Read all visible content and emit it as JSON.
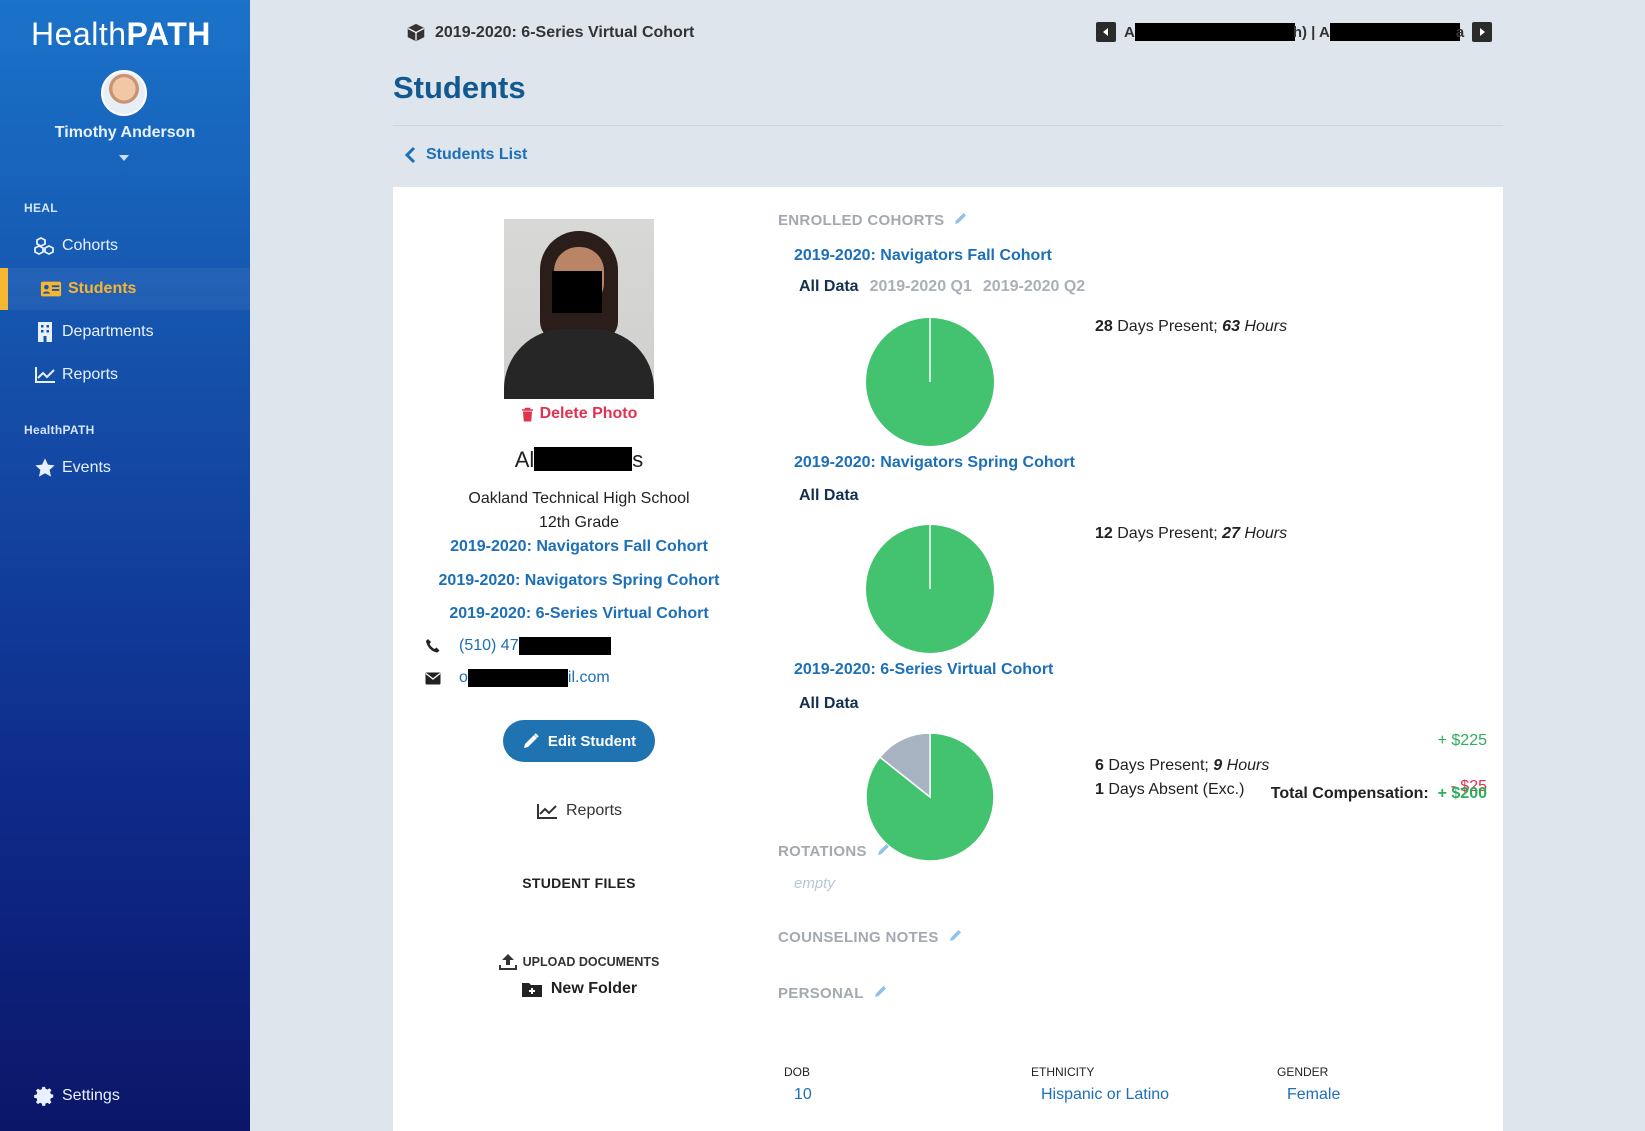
{
  "sidebar": {
    "logo_light": "Health",
    "logo_bold": "PATH",
    "user_name": "Timothy Anderson",
    "sections": {
      "heal": "HEAL",
      "healthpath": "HealthPATH"
    },
    "items": [
      {
        "label": "Cohorts"
      },
      {
        "label": "Students"
      },
      {
        "label": "Departments"
      },
      {
        "label": "Reports"
      },
      {
        "label": "Events"
      },
      {
        "label": "Settings"
      }
    ],
    "active_color": "#f5b731"
  },
  "header": {
    "cohort": "2019-2020: 6-Series Virtual Cohort",
    "student_nav_prefix": "A",
    "student_nav_mid": "h) | A",
    "student_nav_suffix": "a",
    "page_title": "Students",
    "back_link": "Students List"
  },
  "student": {
    "delete_photo": "Delete Photo",
    "name_start": "Al",
    "name_end": "s",
    "school": "Oakland Technical High School",
    "grade": "12th Grade",
    "cohorts": [
      "2019-2020: Navigators Fall Cohort",
      "2019-2020: Navigators Spring Cohort",
      "2019-2020: 6-Series Virtual Cohort"
    ],
    "phone_visible": "(510) 47",
    "email_start": "o",
    "email_end": "il.com",
    "edit_button": "Edit Student",
    "reports_link": "Reports",
    "files_title": "STUDENT FILES",
    "upload": "UPLOAD DOCUMENTS",
    "new_folder": "New Folder"
  },
  "enrolled": {
    "label": "ENROLLED COHORTS",
    "cohorts": [
      {
        "name": "2019-2020: Navigators Fall Cohort",
        "tabs": [
          "All Data",
          "2019-2020 Q1",
          "2019-2020 Q2"
        ],
        "days_present": "28",
        "days_present_text": " Days Present; ",
        "hours": "63",
        "hours_text": " Hours",
        "present_fraction": 1.0
      },
      {
        "name": "2019-2020: Navigators Spring Cohort",
        "tabs": [
          "All Data"
        ],
        "days_present": "12",
        "days_present_text": " Days Present; ",
        "hours": "27",
        "hours_text": " Hours",
        "present_fraction": 1.0
      },
      {
        "name": "2019-2020: 6-Series Virtual Cohort",
        "tabs": [
          "All Data"
        ],
        "days_present": "6",
        "days_present_text": " Days Present; ",
        "hours": "9",
        "hours_text": " Hours",
        "days_absent": "1",
        "days_absent_text": " Days Absent (Exc.)",
        "comp_plus": "+ $225",
        "comp_minus": "- $25",
        "total_label": "Total Compensation:",
        "total_value": "+ $200",
        "present_fraction": 0.857
      }
    ],
    "present_color": "#43c26f",
    "absent_color": "#a8b3c2"
  },
  "rotations": {
    "label": "ROTATIONS",
    "empty": "empty"
  },
  "counseling": {
    "label": "COUNSELING NOTES"
  },
  "personal": {
    "label": "PERSONAL",
    "dob_label": "DOB",
    "dob_value": "10",
    "ethnicity_label": "ETHNICITY",
    "ethnicity_value": "Hispanic or Latino",
    "gender_label": "GENDER",
    "gender_value": "Female"
  }
}
